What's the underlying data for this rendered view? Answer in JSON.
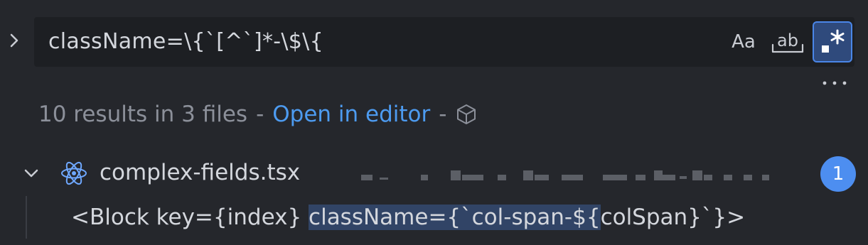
{
  "search": {
    "query": "className=\\{`[^`]*-\\$\\{",
    "options": {
      "match_case_label": "Aa",
      "whole_word_label": "ab",
      "regex_enabled": true
    }
  },
  "summary": {
    "count_text": "10 results in 3 files",
    "separator": "-",
    "open_in_editor": "Open in editor"
  },
  "file": {
    "name": "complex-fields.tsx",
    "match_count": "1"
  },
  "match": {
    "before": "<Block key={index} ",
    "highlighted": "className={`col-span-${",
    "after": "colSpan}`}>"
  },
  "colors": {
    "accent": "#4d9bf0",
    "badge": "#4d8ef0",
    "highlight": "#314466",
    "background": "#25272c"
  }
}
